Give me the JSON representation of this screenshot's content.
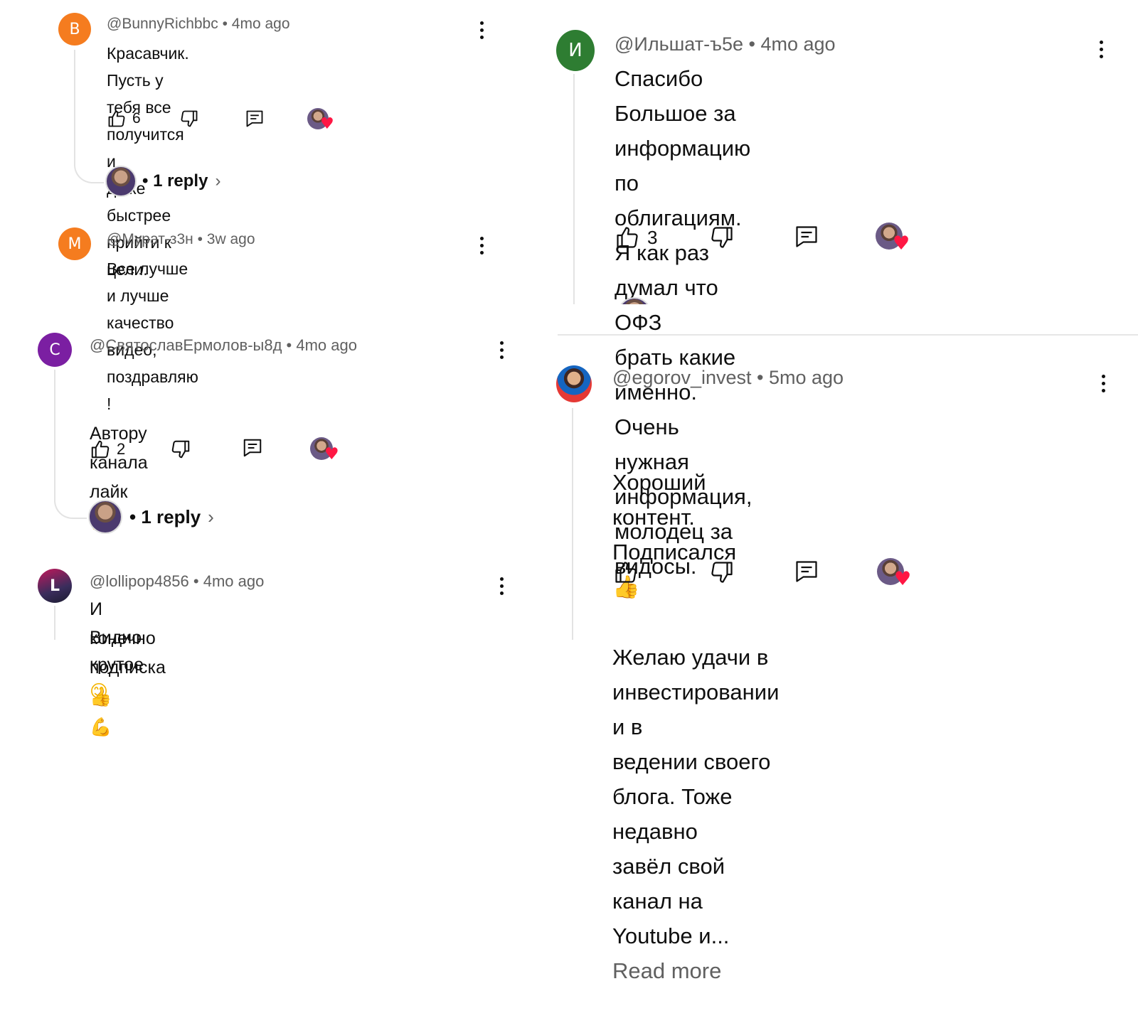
{
  "comments_left": [
    {
      "avatar_letter": "B",
      "avatar_color": "#f57c1f",
      "author": "@BunnyRichbbc",
      "time": "4mo ago",
      "text": "Красавчик. Пусть у тебя все получится и\nдаже быстрее прийти к цели.",
      "likes": "6",
      "replies": "• 1 reply"
    },
    {
      "avatar_letter": "М",
      "avatar_color": "#f57c1f",
      "author": "@Мурат-з3н",
      "time": "3w ago",
      "text": "Все лучше и лучше качество видео,\nпоздравляю !"
    },
    {
      "avatar_letter": "С",
      "avatar_color": "#7b1fa2",
      "author": "@СвятославЕрмолов-ы8д",
      "time": "4mo ago",
      "text_line1": "Автору канала лайк",
      "text_line2": "И конечно подписка",
      "likes": "2",
      "replies": "• 1 reply"
    },
    {
      "avatar_letter": "L",
      "avatar_color": "#8e3b6b",
      "author": "@lollipop4856",
      "time": "4mo ago",
      "text": "Видио крутое"
    }
  ],
  "comments_right": [
    {
      "avatar_letter": "И",
      "avatar_color": "#2e7d32",
      "author": "@Ильшат-ъ5е",
      "time": "4mo ago",
      "text": "Спасибо Большое за информацию по\nоблигациям. Я как раз думал что ОФЗ\nбрать какие именно. Очень нужная\nинформация, молодец за видосы.",
      "likes": "3"
    },
    {
      "author": "@egorov_invest",
      "time": "5mo ago",
      "text_line1": "Хороший контент. Подписался",
      "text_rest": "Желаю удачи в инвестировании и в\nведении своего блога. Тоже недавно\nзавёл свой канал на Youtube и...",
      "read_more": "Read more"
    }
  ],
  "separator": "•",
  "icons": [
    "thumb-up-icon",
    "thumb-down-icon",
    "reply-icon",
    "more-vert-icon",
    "heart-icon",
    "chevron-right-icon",
    "thumbs-up-emoji",
    "flexed-biceps-emoji",
    "smile-emoji"
  ]
}
